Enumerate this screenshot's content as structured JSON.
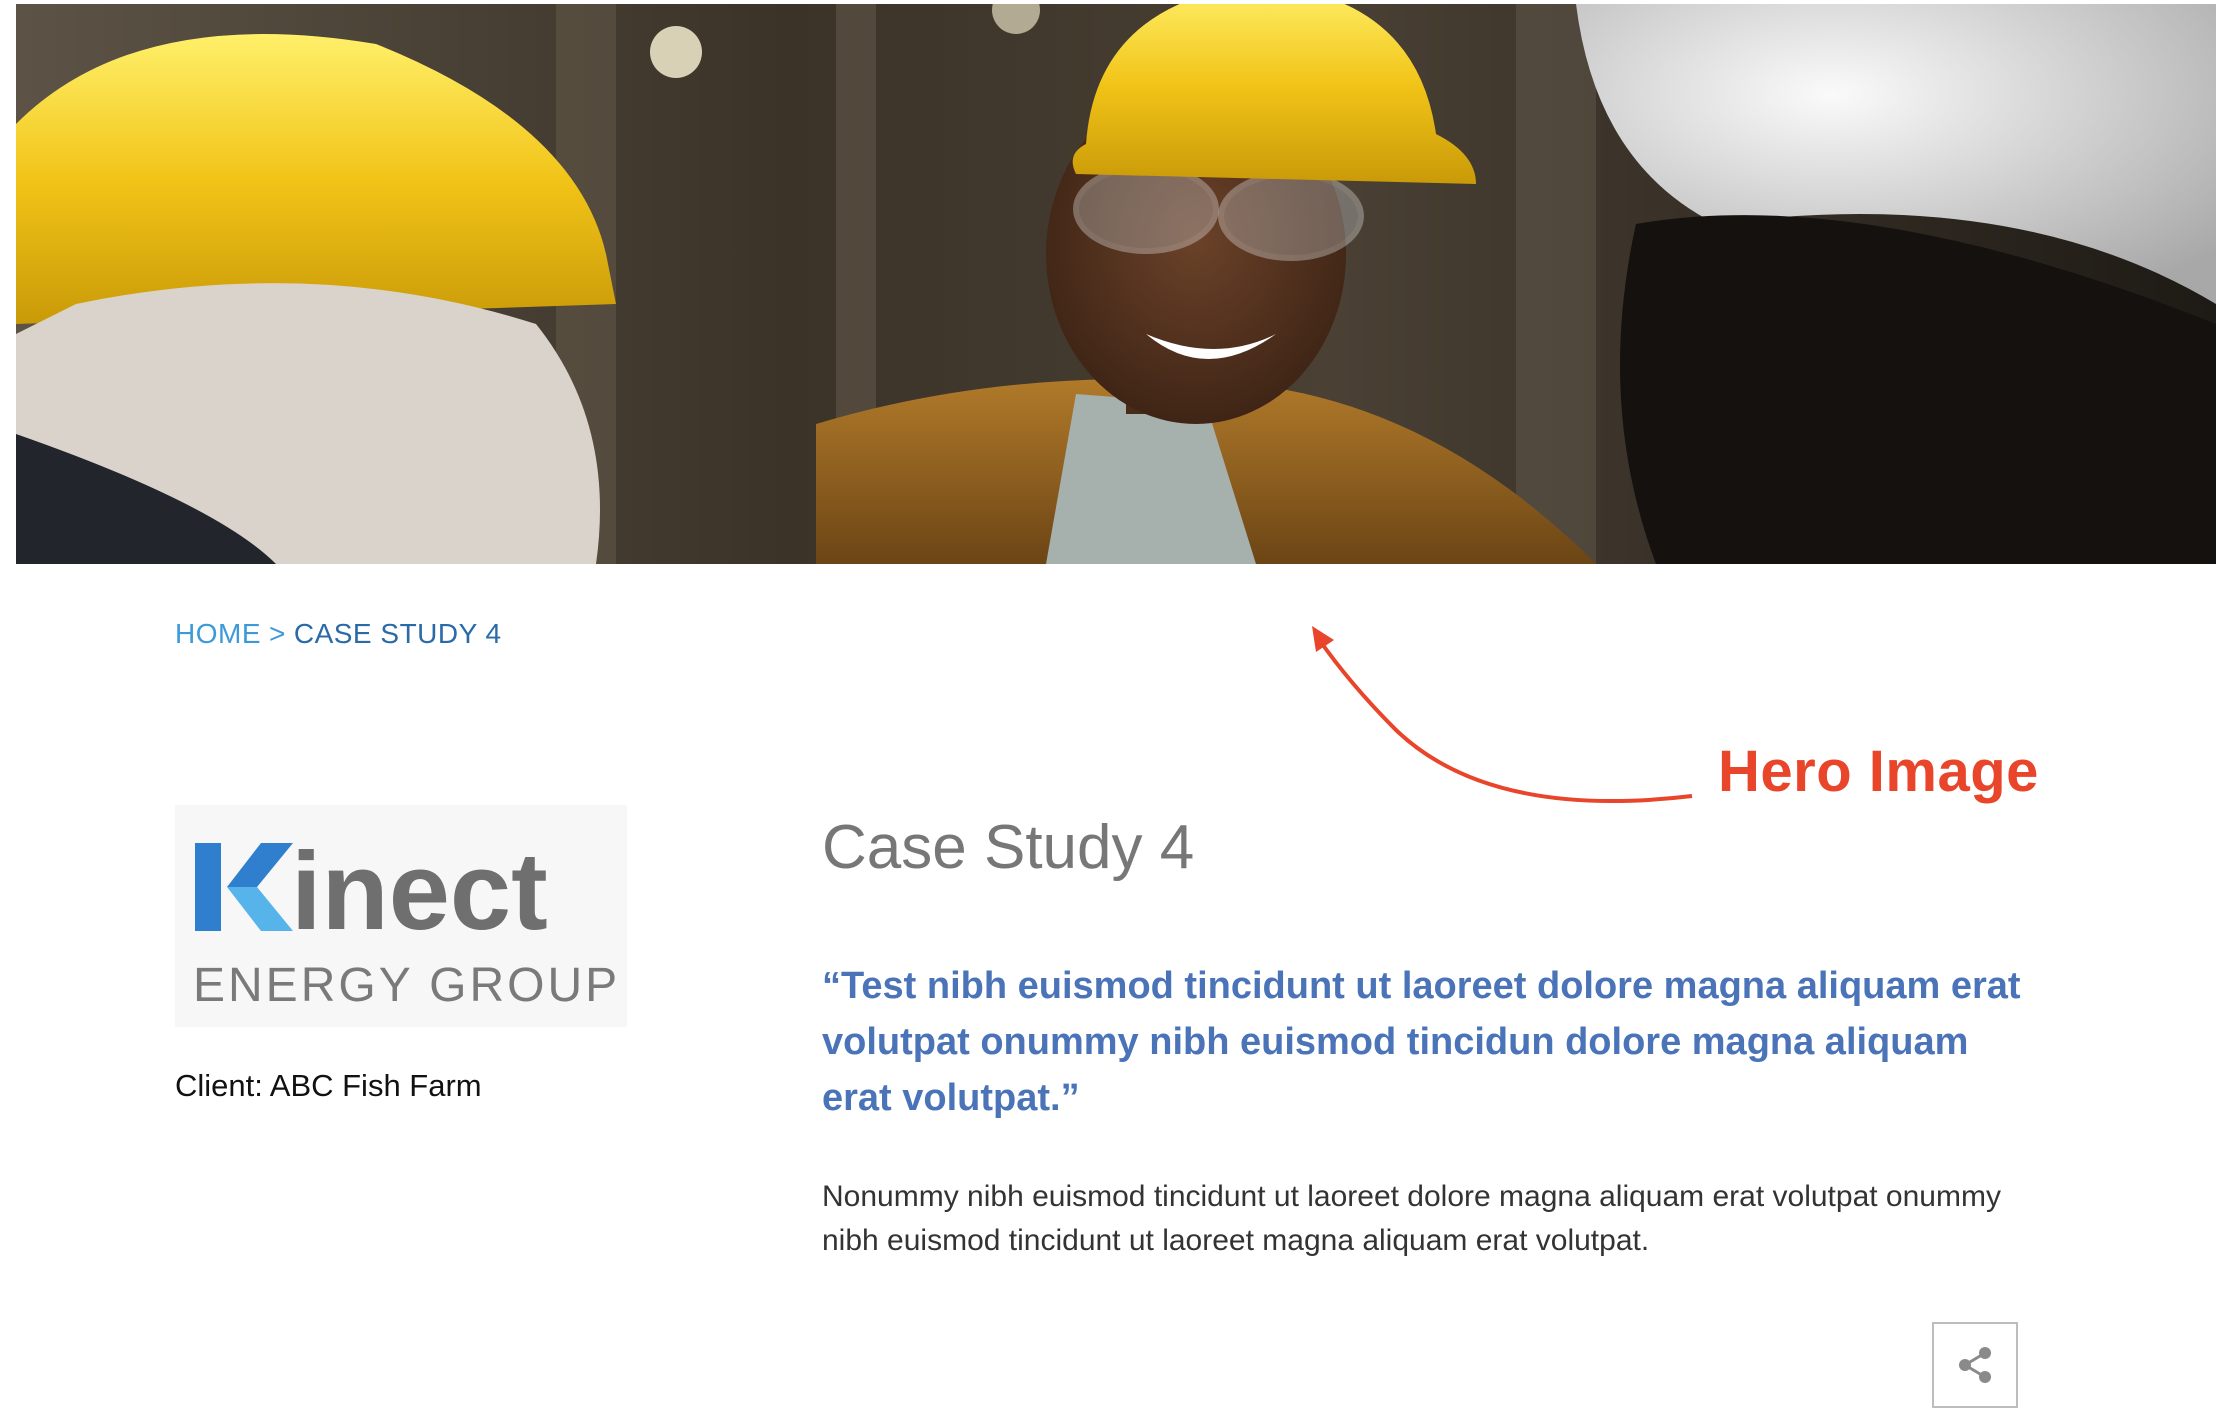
{
  "breadcrumb": {
    "home_label": "HOME",
    "separator": ">",
    "current_label": "CASE STUDY 4"
  },
  "annotation": {
    "label": "Hero Image",
    "color": "#e8452a"
  },
  "logo": {
    "brand_mark": "K",
    "brand_word": "inect",
    "brand_sub": "ENERGY GROUP"
  },
  "client": {
    "text": "Client: ABC Fish Farm"
  },
  "main": {
    "title": "Case Study 4",
    "quote": "“Test nibh euismod tincidunt ut laoreet dolore magna aliquam erat volutpat onummy nibh euismod tincidun dolore magna aliquam erat volutpat.”",
    "body": "Nonummy nibh euismod tincidunt ut laoreet dolore magna aliquam erat volutpat onummy nibh euismod tincidunt ut laoreet magna aliquam erat volutpat."
  },
  "share": {
    "icon": "share-icon"
  },
  "colors": {
    "link_blue": "#3d9ad8",
    "quote_blue": "#4a73b8",
    "title_gray": "#777777",
    "annotation_red": "#e8452a",
    "hard_hat_yellow": "#f2c418"
  }
}
